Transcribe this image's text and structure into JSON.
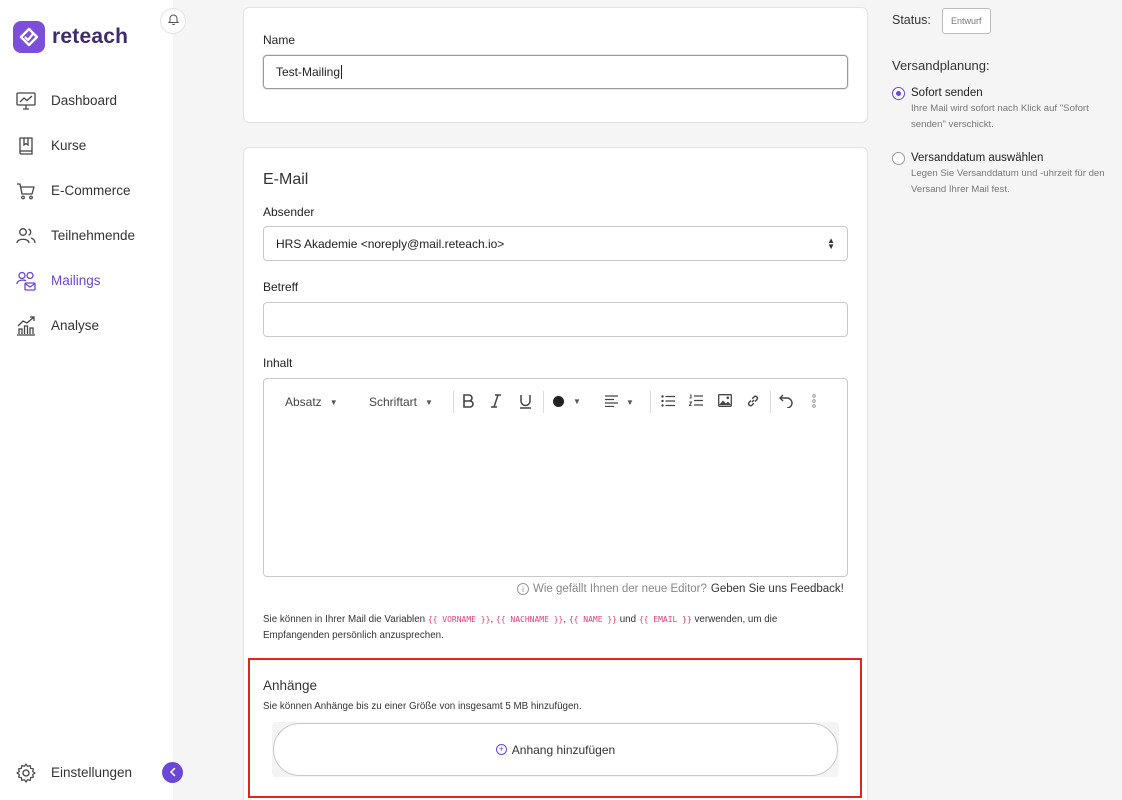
{
  "app": {
    "brand_name": "reteach",
    "accent_color": "#6b47d6"
  },
  "sidebar": {
    "items": [
      {
        "label": "Dashboard",
        "icon": "dashboard-icon"
      },
      {
        "label": "Kurse",
        "icon": "book-icon"
      },
      {
        "label": "E-Commerce",
        "icon": "cart-icon"
      },
      {
        "label": "Teilnehmende",
        "icon": "users-icon"
      },
      {
        "label": "Mailings",
        "icon": "mailings-icon",
        "active": true
      },
      {
        "label": "Analyse",
        "icon": "chart-icon"
      }
    ],
    "settings_label": "Einstellungen"
  },
  "name_card": {
    "label": "Name",
    "value": "Test-Mailing"
  },
  "email_card": {
    "title": "E-Mail",
    "sender_label": "Absender",
    "sender_value": "HRS Akademie <noreply@mail.reteach.io>",
    "subject_label": "Betreff",
    "subject_value": "",
    "content_label": "Inhalt",
    "toolbar": {
      "paragraph": "Absatz",
      "font": "Schriftart"
    },
    "feedback_question": "Wie gefällt Ihnen der neue Editor?",
    "feedback_link": "Geben Sie uns Feedback!",
    "hint_before": "Sie können in Ihrer Mail die Variablen ",
    "var_vorname": "{{ VORNAME }}",
    "var_nachname": "{{ NACHNAME }}",
    "var_name": "{{ NAME }}",
    "and_word": "und",
    "var_email": "{{ EMAIL }}",
    "hint_after": " verwenden, um die Empfangenden persönlich anzusprechen.",
    "comma": ","
  },
  "attachments": {
    "title": "Anhänge",
    "hint": "Sie können Anhänge bis zu einer Größe von insgesamt 5 MB hinzufügen.",
    "add_label": "Anhang hinzufügen"
  },
  "right_panel": {
    "status_label": "Status:",
    "status_value": "Entwurf",
    "plan_title": "Versandplanung:",
    "options": [
      {
        "title": "Sofort senden",
        "desc": "Ihre Mail wird sofort nach Klick auf \"Sofort senden\" verschickt.",
        "checked": true
      },
      {
        "title": "Versanddatum auswählen",
        "desc": "Legen Sie Versanddatum und -uhrzeit für den Versand Ihrer Mail fest.",
        "checked": false
      }
    ]
  }
}
